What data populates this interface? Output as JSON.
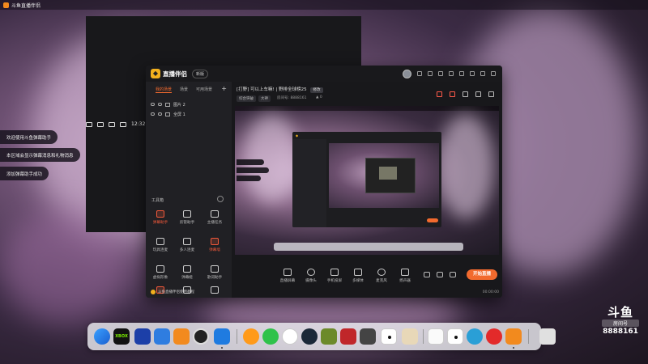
{
  "menubar": {
    "app_title": "斗鱼直播伴侣",
    "clock": "12:32"
  },
  "notifications": [
    "欢迎使用斗鱼弹幕助手",
    "本区域会显示弹幕消息和礼物消息",
    "添加弹幕助手成功"
  ],
  "window": {
    "logo_text": "直播伴侣",
    "version_label": "新版"
  },
  "left_panel": {
    "tabs": [
      "我的场景",
      "场景",
      "可用场景"
    ],
    "add_label": "+",
    "scenes": [
      {
        "label": "图片 2"
      },
      {
        "label": "全屏 1"
      }
    ],
    "toolbox_title": "工具箱",
    "tools": [
      {
        "label": "弹幕助手",
        "highlight": true
      },
      {
        "label": "房管助手",
        "highlight": false
      },
      {
        "label": "主播任务",
        "highlight": false
      },
      {
        "label": "玩具连麦",
        "highlight": false
      },
      {
        "label": "多人连麦",
        "highlight": false
      },
      {
        "label": "弹幕墙",
        "highlight": true
      },
      {
        "label": "虚拟形象",
        "highlight": false
      },
      {
        "label": "弹幕姬",
        "highlight": false
      },
      {
        "label": "歌词助手",
        "highlight": false
      }
    ],
    "bottom_status": "斗鱼直播伴侣使用教程"
  },
  "right_panel": {
    "room_title": "[打野] 可以上车嘛! | 野排全球榜25",
    "room_tag": "修改",
    "chips": [
      "综合突破",
      "大神"
    ],
    "room_id": "房间号: 8888161",
    "fans": "0",
    "actions": [
      "直播屏幕",
      "摄像头",
      "手机投屏",
      "多媒体",
      "麦克风",
      "扬声器"
    ],
    "live_button": "开始直播",
    "status_time": "00:00:00"
  },
  "watermark": {
    "logo": "斗鱼",
    "sub": "房间号",
    "room": "8888161"
  },
  "colors": {
    "accent": "#f26a2e",
    "brand": "#f2b01e"
  }
}
